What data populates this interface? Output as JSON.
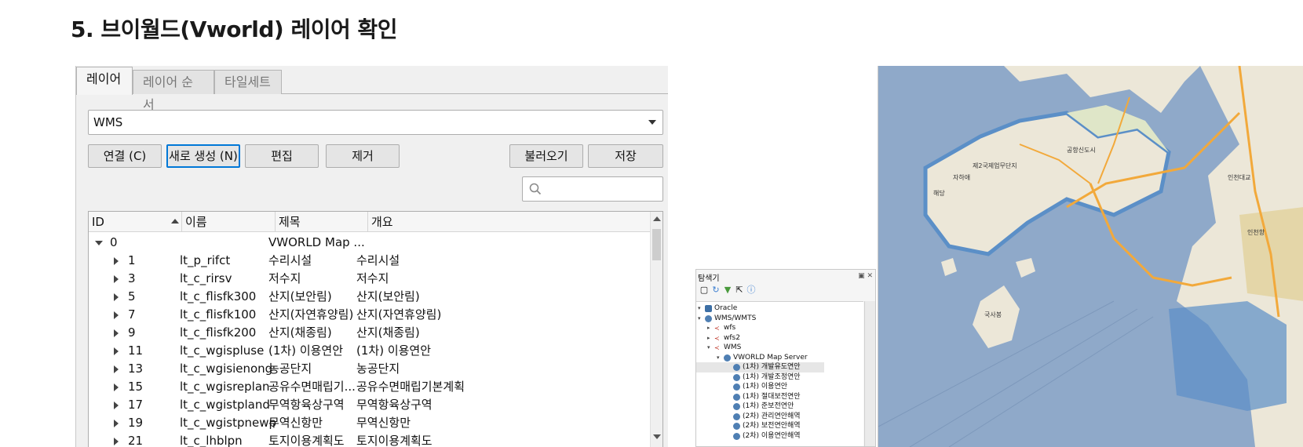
{
  "page": {
    "title": "5. 브이월드(Vworld) 레이어 확인"
  },
  "dialog": {
    "tabs": [
      "레이어",
      "레이어 순서",
      "타일세트"
    ],
    "active_tab": "레이어",
    "connection": {
      "value": "WMS"
    },
    "buttons": {
      "connect": "연결 (C)",
      "new": "새로 생성 (N)",
      "edit": "편집",
      "remove": "제거",
      "load": "불러오기",
      "save": "저장"
    },
    "search": {
      "placeholder": ""
    },
    "columns": [
      "ID",
      "이름",
      "제목",
      "개요"
    ],
    "root": {
      "id": "0",
      "name": "",
      "title": "VWORLD Map ...",
      "abstract": ""
    },
    "rows": [
      {
        "id": "1",
        "name": "lt_p_rifct",
        "title": "수리시설",
        "abstract": "수리시설"
      },
      {
        "id": "3",
        "name": "lt_c_rirsv",
        "title": "저수지",
        "abstract": "저수지"
      },
      {
        "id": "5",
        "name": "lt_c_flisfk300",
        "title": "산지(보안림)",
        "abstract": "산지(보안림)"
      },
      {
        "id": "7",
        "name": "lt_c_flisfk100",
        "title": "산지(자연휴양림)",
        "abstract": "산지(자연휴양림)"
      },
      {
        "id": "9",
        "name": "lt_c_flisfk200",
        "title": "산지(채종림)",
        "abstract": "산지(채종림)"
      },
      {
        "id": "11",
        "name": "lt_c_wgispluse",
        "title": "(1차) 이용연안",
        "abstract": "(1차) 이용연안"
      },
      {
        "id": "13",
        "name": "lt_c_wgisienong",
        "title": "농공단지",
        "abstract": "농공단지"
      },
      {
        "id": "15",
        "name": "lt_c_wgisreplan",
        "title": "공유수면매립기...",
        "abstract": "공유수면매립기본계획"
      },
      {
        "id": "17",
        "name": "lt_c_wgistpland",
        "title": "무역항육상구역",
        "abstract": "무역항육상구역"
      },
      {
        "id": "19",
        "name": "lt_c_wgistpnewp",
        "title": "무역신항만",
        "abstract": "무역신항만"
      },
      {
        "id": "21",
        "name": "lt_c_lhblpn",
        "title": "토지이용계획도",
        "abstract": "토지이용계획도"
      }
    ]
  },
  "browser": {
    "title": "탐색기",
    "items": [
      {
        "label": "Oracle",
        "level": 0,
        "icon": "oracle-icon"
      },
      {
        "label": "WMS/WMTS",
        "level": 0,
        "icon": "globe-icon"
      },
      {
        "label": "wfs",
        "level": 1,
        "icon": "wms-connection-icon"
      },
      {
        "label": "wfs2",
        "level": 1,
        "icon": "wms-connection-icon"
      },
      {
        "label": "WMS",
        "level": 1,
        "icon": "wms-connection-icon"
      },
      {
        "label": "VWORLD Map Server",
        "level": 2,
        "icon": "globe-icon"
      },
      {
        "label": "(1차) 개발유도연안",
        "level": 3,
        "icon": "globe-icon",
        "selected": true
      },
      {
        "label": "(1차) 개발조정연안",
        "level": 3,
        "icon": "globe-icon"
      },
      {
        "label": "(1차) 이용연안",
        "level": 3,
        "icon": "globe-icon"
      },
      {
        "label": "(1차) 절대보전연안",
        "level": 3,
        "icon": "globe-icon"
      },
      {
        "label": "(1차) 준보전연안",
        "level": 3,
        "icon": "globe-icon"
      },
      {
        "label": "(2차) 관리연안해역",
        "level": 3,
        "icon": "globe-icon"
      },
      {
        "label": "(2차) 보전연안해역",
        "level": 3,
        "icon": "globe-icon"
      },
      {
        "label": "(2차) 이용연안해역",
        "level": 3,
        "icon": "globe-icon"
      }
    ]
  },
  "map": {
    "labels": [
      "제2국제업무단지",
      "자하애",
      "해당",
      "공항신도시",
      "인천대교",
      "국사봉",
      "인천항"
    ],
    "colors": {
      "sea": "#8fa9c9",
      "land": "#ece7d8",
      "road": "#f2a93b",
      "zone": "#5b8fc7"
    }
  }
}
